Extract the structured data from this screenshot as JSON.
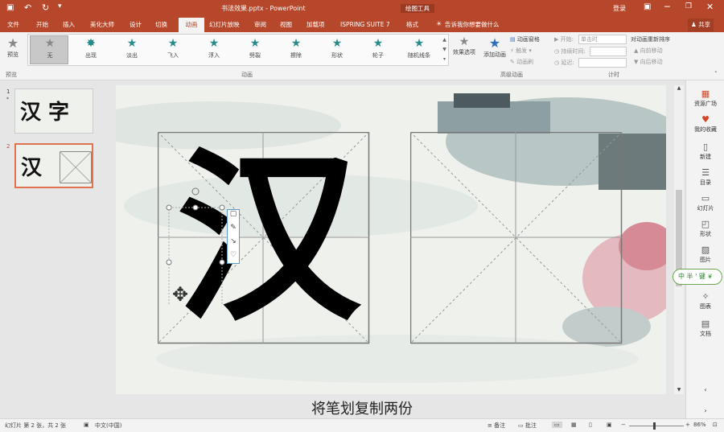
{
  "titlebar": {
    "filename": "书法效果.pptx - PowerPoint",
    "tool": "绘图工具",
    "login": "登录"
  },
  "tabs": [
    "文件",
    "开始",
    "插入",
    "美化大师",
    "设计",
    "切换",
    "动画",
    "幻灯片放映",
    "审阅",
    "视图",
    "加载项",
    "ISPRING SUITE 7",
    "格式"
  ],
  "active_tab": "动画",
  "tell_me": "告诉我你想要做什么",
  "share": "共享",
  "ribbon": {
    "preview": "预览",
    "animations": [
      "无",
      "出现",
      "淡出",
      "飞入",
      "浮入",
      "劈裂",
      "擦除",
      "形状",
      "轮子",
      "随机线条"
    ],
    "effect_options": "效果选项",
    "add_animation": "添加动画",
    "animation_pane": "动画窗格",
    "trigger": "触发",
    "animation_painter": "动画刷",
    "start_label": "开始:",
    "start_value": "单击时",
    "duration_label": "持续时间:",
    "delay_label": "延迟:",
    "reorder": "对动画重新排序",
    "move_earlier": "向前移动",
    "move_later": "向后移动",
    "groups": {
      "preview": "预览",
      "animation": "动画",
      "advanced": "高级动画",
      "timing": "计时"
    }
  },
  "thumbnails": [
    {
      "num": "1",
      "text": "汉 字"
    },
    {
      "num": "2",
      "text": "汉"
    }
  ],
  "slide": {
    "character": "汉"
  },
  "caption": "将笔划复制两份",
  "rightpane": [
    "资源广场",
    "我的收藏",
    "新建",
    "目录",
    "幻灯片",
    "形状",
    "图片",
    "图表",
    "文档"
  ],
  "ime": "中 半 ' 键",
  "status": {
    "slide": "幻灯片 第 2 张，共 2 张",
    "lang": "中文(中国)",
    "notes": "备注",
    "comments": "批注",
    "zoom": "86%"
  }
}
